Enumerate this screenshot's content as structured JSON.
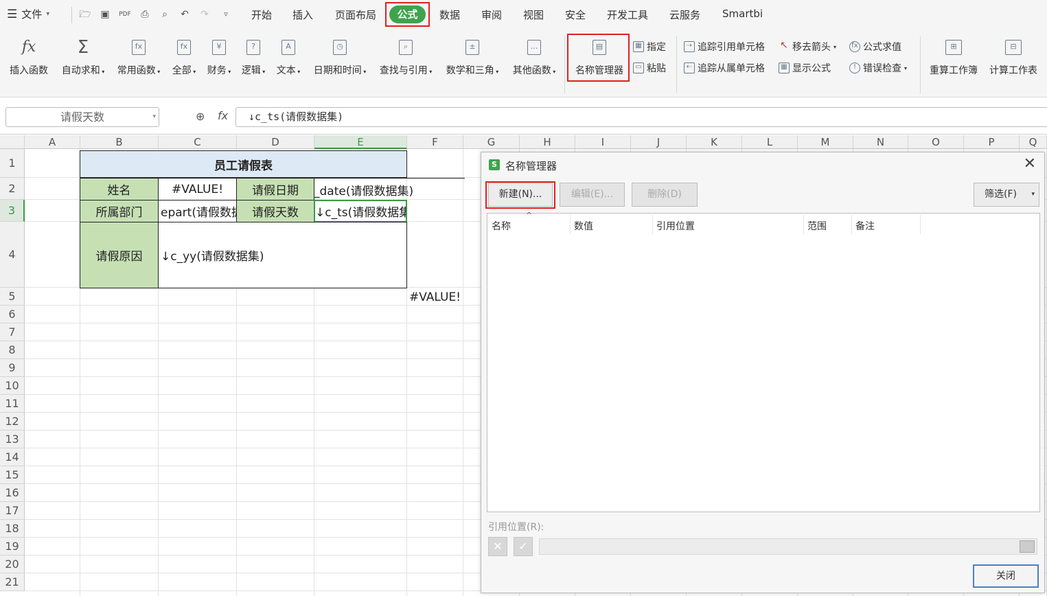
{
  "menu": {
    "file": "文件",
    "tabs": [
      "开始",
      "插入",
      "页面布局",
      "公式",
      "数据",
      "审阅",
      "视图",
      "安全",
      "开发工具",
      "云服务",
      "Smartbi"
    ],
    "active_tab": "公式"
  },
  "ribbon": {
    "insert_fn": "插入函数",
    "autosum": "自动求和",
    "common_fn": "常用函数",
    "all": "全部",
    "finance": "财务",
    "logic": "逻辑",
    "text": "文本",
    "datetime": "日期和时间",
    "lookup": "查找与引用",
    "math": "数学和三角",
    "other_fn": "其他函数",
    "name_mgr": "名称管理器",
    "assign": "指定",
    "paste": "粘贴",
    "trace_prec": "追踪引用单元格",
    "trace_dep": "追踪从属单元格",
    "remove_arrows": "移去箭头",
    "show_formula": "显示公式",
    "eval_formula": "公式求值",
    "error_check": "错误检查",
    "recalc_book": "重算工作簿",
    "calc_sheet": "计算工作表"
  },
  "formula_bar": {
    "name_box": "请假天数",
    "fx": "fx",
    "formula": "↓c_ts(请假数据集)"
  },
  "sheet": {
    "columns": [
      "A",
      "B",
      "C",
      "D",
      "E",
      "F",
      "G",
      "H",
      "I",
      "J",
      "K",
      "L",
      "M",
      "N",
      "O",
      "P",
      "Q"
    ],
    "rows": [
      "1",
      "2",
      "3",
      "4",
      "5",
      "6",
      "7",
      "8",
      "9",
      "10",
      "11",
      "12",
      "13",
      "14",
      "15",
      "16",
      "17",
      "18",
      "19",
      "20",
      "21"
    ],
    "title": "员工请假表",
    "b2": "姓名",
    "c2": "#VALUE!",
    "d2": "请假日期",
    "e2": "_date(请假数据集)",
    "b3": "所属部门",
    "c3": "epart(请假数据",
    "d3": "请假天数",
    "e3": "↓c_ts(请假数据集)",
    "b4": "请假原因",
    "c4": "↓c_yy(请假数据集)",
    "f5": "#VALUE!"
  },
  "dialog": {
    "title": "名称管理器",
    "new": "新建(N)...",
    "edit": "编辑(E)...",
    "delete": "删除(D)",
    "filter": "筛选(F)",
    "headers": [
      "名称",
      "数值",
      "引用位置",
      "范围",
      "备注"
    ],
    "ref_label": "引用位置(R):",
    "close": "关闭"
  }
}
